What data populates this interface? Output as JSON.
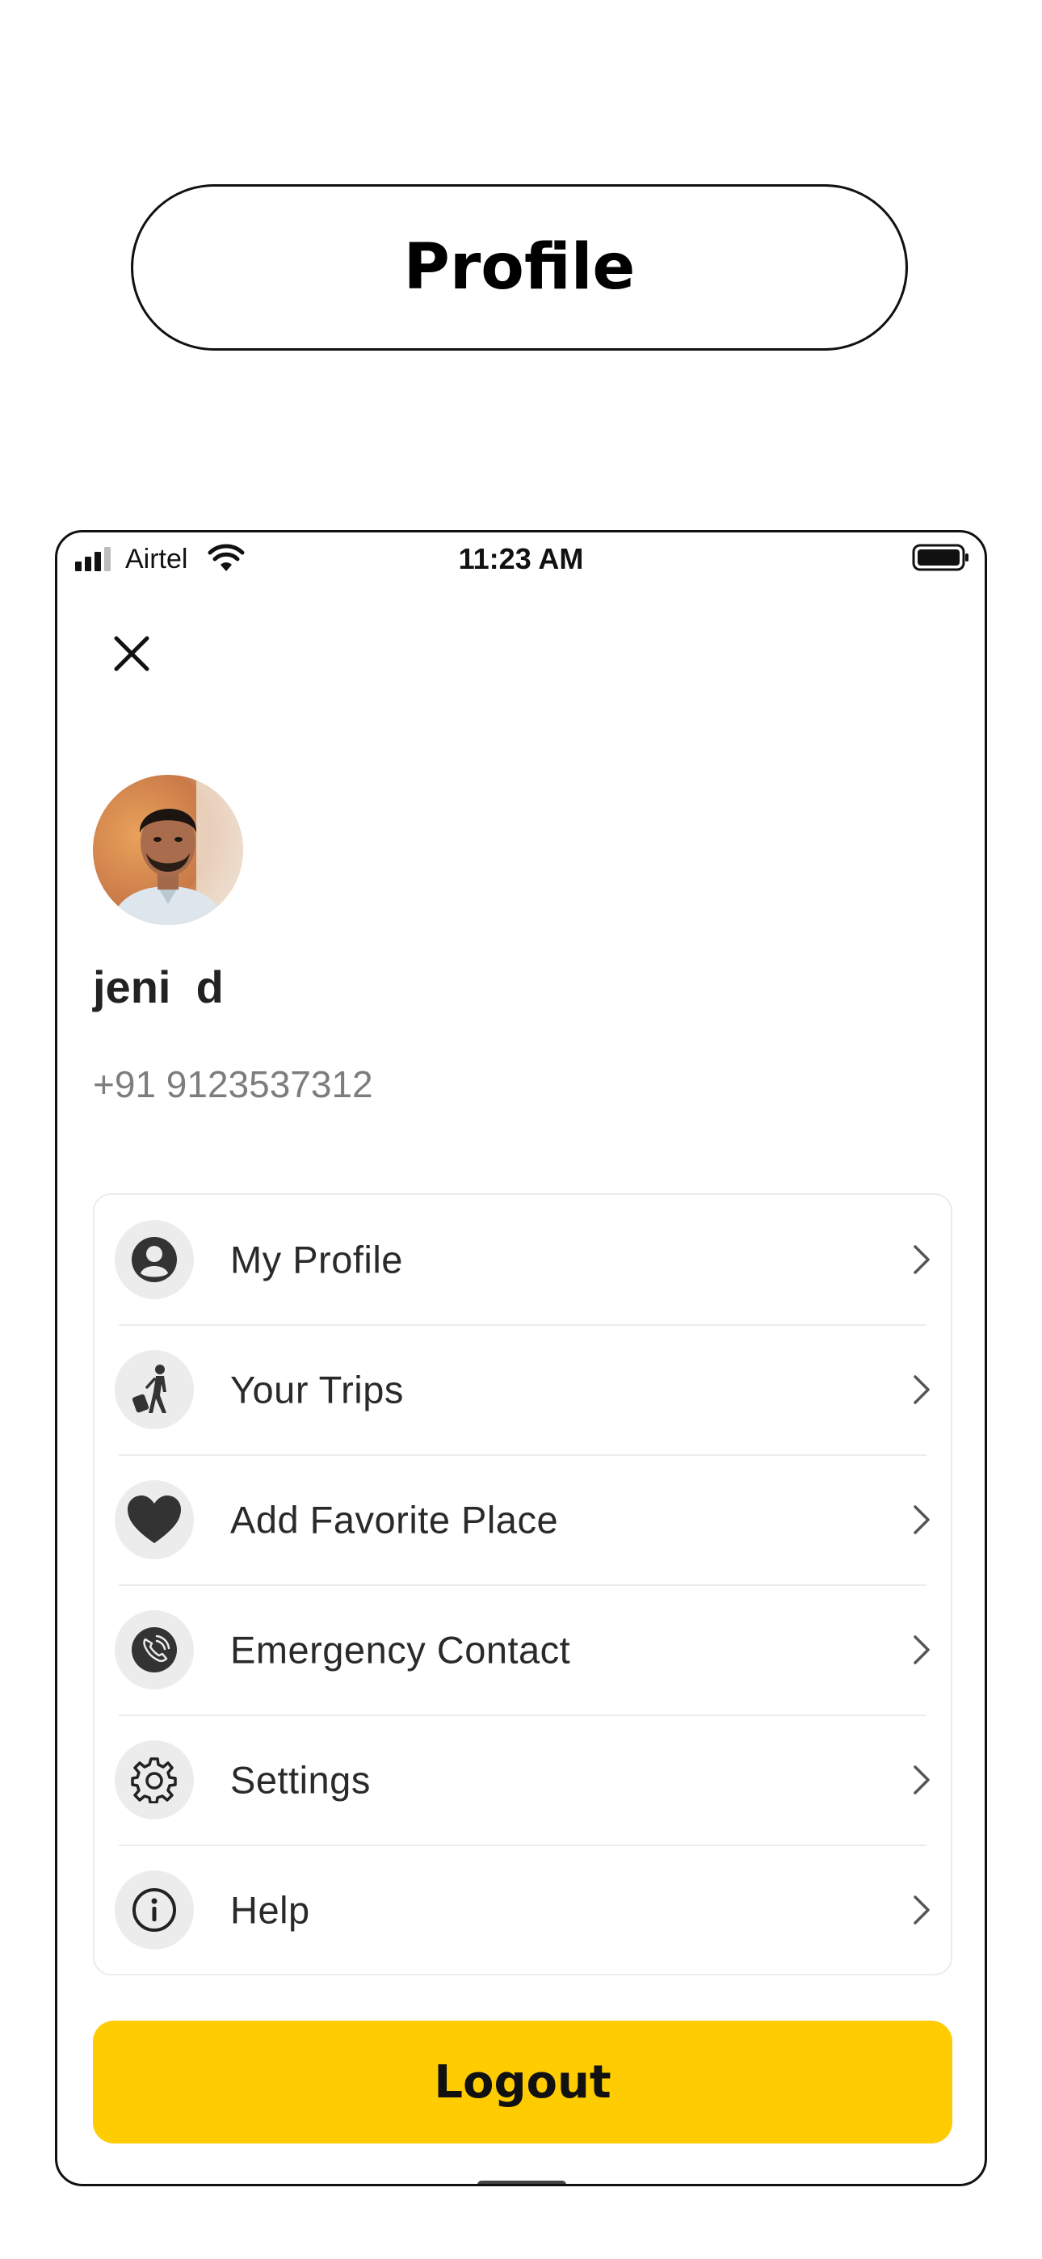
{
  "header": {
    "title": "Profile"
  },
  "status_bar": {
    "carrier": "Airtel",
    "time": "11:23 AM"
  },
  "profile": {
    "name": "jeni  d",
    "phone": "+91 9123537312"
  },
  "menu": {
    "items": [
      {
        "label": "My Profile",
        "icon": "user-circle-icon"
      },
      {
        "label": "Your Trips",
        "icon": "traveler-icon"
      },
      {
        "label": "Add Favorite Place",
        "icon": "heart-icon"
      },
      {
        "label": "Emergency Contact",
        "icon": "phone-call-icon"
      },
      {
        "label": "Settings",
        "icon": "gear-icon"
      },
      {
        "label": "Help",
        "icon": "info-icon"
      }
    ]
  },
  "actions": {
    "logout_label": "Logout"
  },
  "colors": {
    "accent": "#fecc00",
    "icon_bg": "#ececec",
    "muted_text": "#7d7d7d"
  }
}
